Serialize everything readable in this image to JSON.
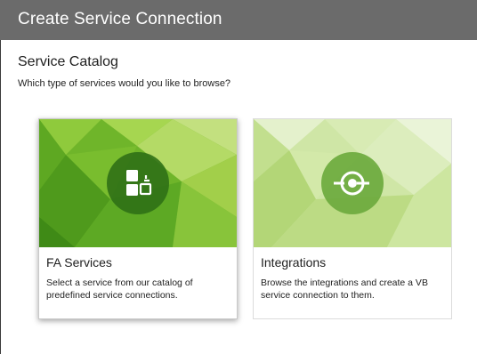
{
  "dialog": {
    "title": "Create Service Connection"
  },
  "catalog": {
    "title": "Service Catalog",
    "subtitle": "Which type of services would you like to browse?"
  },
  "cards": [
    {
      "title": "FA Services",
      "description": "Select a service from our catalog of predefined service connections.",
      "icon": "fa-services-blocks-icon",
      "selected": true
    },
    {
      "title": "Integrations",
      "description": "Browse the integrations and create a VB service connection to them.",
      "icon": "integration-connector-icon",
      "selected": false
    }
  ],
  "colors": {
    "title_bar": "#6b6b6b",
    "card_green_dark": "#2e6e16",
    "card_green_light": "#a9d45e"
  }
}
